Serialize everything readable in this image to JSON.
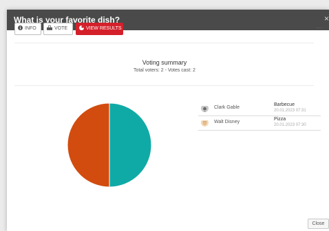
{
  "modal": {
    "title": "What is your favorite dish?"
  },
  "toolbar": {
    "info_label": "INFO",
    "vote_label": "VOTE",
    "results_label": "VIEW RESULTS",
    "more_label": "···"
  },
  "summary": {
    "title": "Voting summary",
    "subtitle": "Total voters: 2  -  Votes cast: 2"
  },
  "votes": [
    {
      "name": "Clark Gable",
      "choice": "Barbecue",
      "date": "20.01.2023 07:31"
    },
    {
      "name": "Walt Disney",
      "choice": "Pizza",
      "date": "20.01.2023 07:30"
    }
  ],
  "chart_data": {
    "type": "pie",
    "slices": [
      {
        "value": 1,
        "color": "#10aaa6"
      },
      {
        "value": 1,
        "color": "#d24c0f"
      }
    ]
  },
  "footer": {
    "close_label": "Close"
  },
  "colors": {
    "header_bg": "#4a4a4a",
    "accent_red": "#d4202a",
    "slice_teal": "#10aaa6",
    "slice_orange": "#d24c0f"
  }
}
